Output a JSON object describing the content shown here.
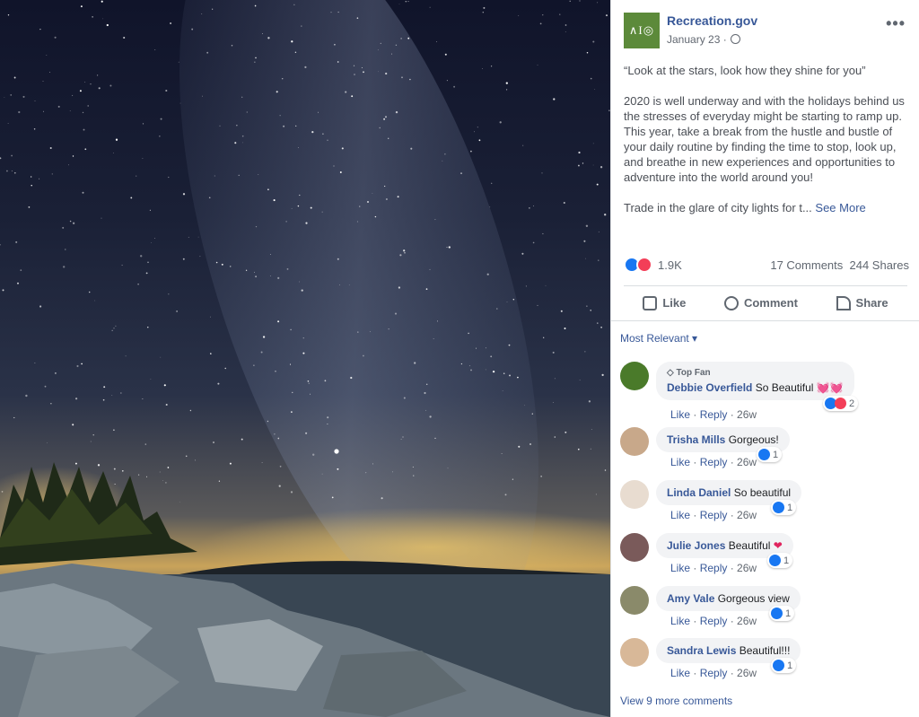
{
  "post": {
    "page_name": "Recreation.gov",
    "logo_text": "∧I◎",
    "date": "January 23 ·",
    "paragraphs": [
      "“Look at the stars, look how they shine for you”",
      "2020 is well underway and with the holidays behind us the stresses of everyday might be starting to ramp up. This year, take a break from the hustle and bustle of your daily routine by finding the time to stop, look up, and breathe in new experiences and opportunities to adventure into the world around you!",
      "Trade in the glare of city lights for t..."
    ],
    "see_more": "See More"
  },
  "stats": {
    "reactions": "1.9K",
    "comments": "17 Comments",
    "shares": "244 Shares"
  },
  "actions": {
    "like": "Like",
    "comment": "Comment",
    "share": "Share"
  },
  "comments_sort": "Most Relevant ▾",
  "comments": [
    {
      "topfan": "Top Fan",
      "author": "Debbie Overfield",
      "text": "So Beautiful",
      "emoji": "💓💓",
      "like": "Like",
      "reply": "Reply",
      "age": "26w",
      "reactions": "2"
    },
    {
      "author": "Trisha Mills",
      "text": "Gorgeous!",
      "like": "Like",
      "reply": "Reply",
      "age": "26w",
      "reactions": "1"
    },
    {
      "author": "Linda Daniel",
      "text": "So beautiful",
      "like": "Like",
      "reply": "Reply",
      "age": "26w",
      "reactions": "1"
    },
    {
      "author": "Julie Jones",
      "text": "Beautiful",
      "emoji": "❤",
      "like": "Like",
      "reply": "Reply",
      "age": "26w",
      "reactions": "1"
    },
    {
      "author": "Amy Vale",
      "text": "Gorgeous view",
      "like": "Like",
      "reply": "Reply",
      "age": "26w",
      "reactions": "1"
    },
    {
      "author": "Sandra Lewis",
      "text": "Beautiful!!!",
      "like": "Like",
      "reply": "Reply",
      "age": "26w",
      "reactions": "1"
    }
  ],
  "view_more": "View 9 more comments",
  "colors": {
    "link": "#385898",
    "like_blue": "#1877f2",
    "love_red": "#f33e58",
    "logo_green": "#5c8a3a"
  }
}
